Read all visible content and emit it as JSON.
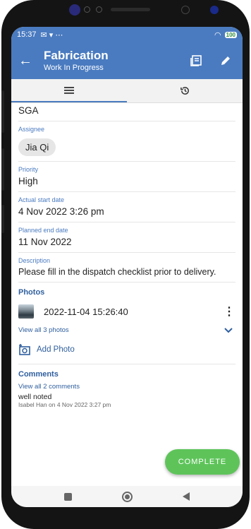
{
  "status_bar": {
    "time": "15:37",
    "battery": "100"
  },
  "app_bar": {
    "title": "Fabrication",
    "subtitle": "Work In Progress"
  },
  "tabs": [
    {
      "name": "details",
      "icon": "menu-icon"
    },
    {
      "name": "history",
      "icon": "history-icon"
    }
  ],
  "fields": {
    "top_value": "SGA",
    "assignee": {
      "label": "Assignee",
      "value": "Jia Qi"
    },
    "priority": {
      "label": "Priority",
      "value": "High"
    },
    "actual_start": {
      "label": "Actual start date",
      "value": "4 Nov 2022 3:26 pm"
    },
    "planned_end": {
      "label": "Planned end date",
      "value": "11 Nov 2022"
    },
    "description": {
      "label": "Description",
      "value": "Please fill in the dispatch checklist prior to delivery."
    }
  },
  "photos": {
    "title": "Photos",
    "item_timestamp": "2022-11-04 15:26:40",
    "view_all": "View all 3 photos",
    "add_label": "Add Photo"
  },
  "comments": {
    "title": "Comments",
    "view_all": "View all 2 comments",
    "latest_text": "well noted",
    "latest_meta": "Isabel Han on 4 Nov 2022 3:27 pm"
  },
  "fab": {
    "label": "COMPLETE",
    "color": "#5ec45a"
  },
  "colors": {
    "primary": "#4a7bc0",
    "accent_text": "#2f5f9e"
  }
}
